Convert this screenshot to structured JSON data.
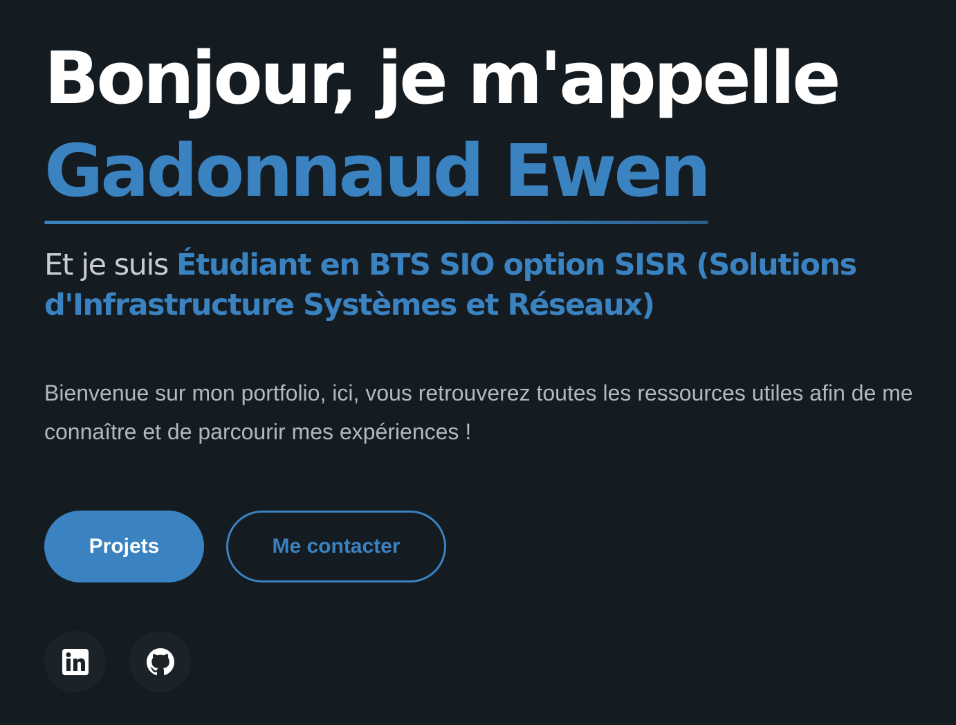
{
  "hero": {
    "title_line1": "Bonjour, je m'appelle",
    "name": "Gadonnaud Ewen",
    "subtitle_prefix": "Et je suis ",
    "subtitle_role": "Étudiant en BTS SIO option SISR (Solutions d'Infrastructure Systèmes et Réseaux)",
    "intro": "Bienvenue sur mon portfolio, ici, vous retrouverez toutes les ressources utiles afin de me connaître et de parcourir mes expériences !"
  },
  "buttons": {
    "primary_label": "Projets",
    "secondary_label": "Me contacter"
  },
  "socials": [
    {
      "icon": "linkedin-icon"
    },
    {
      "icon": "github-icon"
    }
  ],
  "colors": {
    "background": "#141b21",
    "accent": "#3a82c0",
    "text": "#ffffff",
    "muted": "#b3b8bd"
  }
}
